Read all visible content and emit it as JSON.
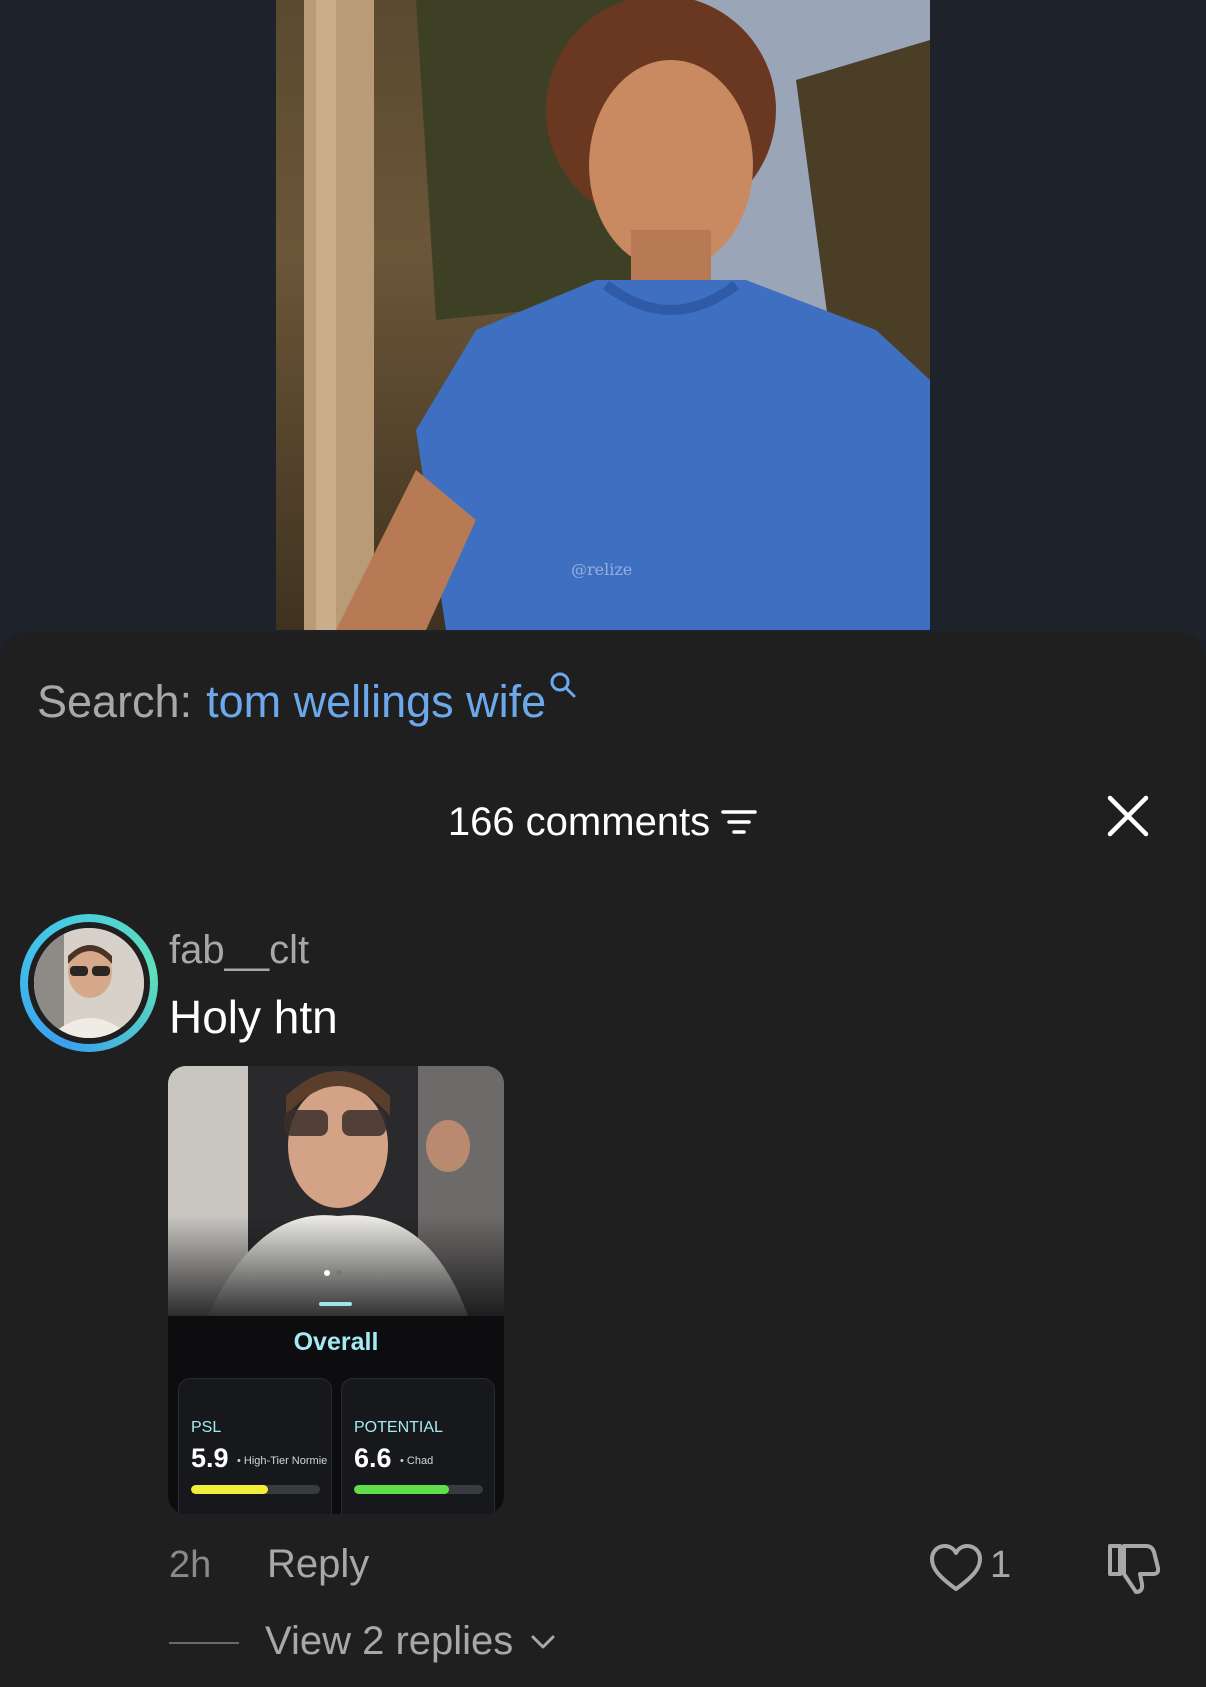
{
  "video": {
    "watermark": "@relize"
  },
  "search": {
    "label": "Search:",
    "query": "tom wellings wife",
    "icon": "search-icon"
  },
  "comments_header": {
    "count_label": "166 comments",
    "filter_icon": "filter-icon",
    "close_icon": "close-icon"
  },
  "comment": {
    "username": "fab__clt",
    "text": "Holy htn",
    "time": "2h",
    "reply_label": "Reply",
    "like_count": "1",
    "view_replies_label": "View 2 replies",
    "ring_colors": [
      "#3aa0ef",
      "#5fe0b8"
    ],
    "card": {
      "title": "Overall",
      "psl": {
        "label": "PSL",
        "value": "5.9",
        "tier": "High-Tier Normie",
        "fill": 0.6,
        "color": "#f2ec3a"
      },
      "potential": {
        "label": "POTENTIAL",
        "value": "6.6",
        "tier": "Chad",
        "fill": 0.74,
        "color": "#5fe04a"
      }
    }
  }
}
